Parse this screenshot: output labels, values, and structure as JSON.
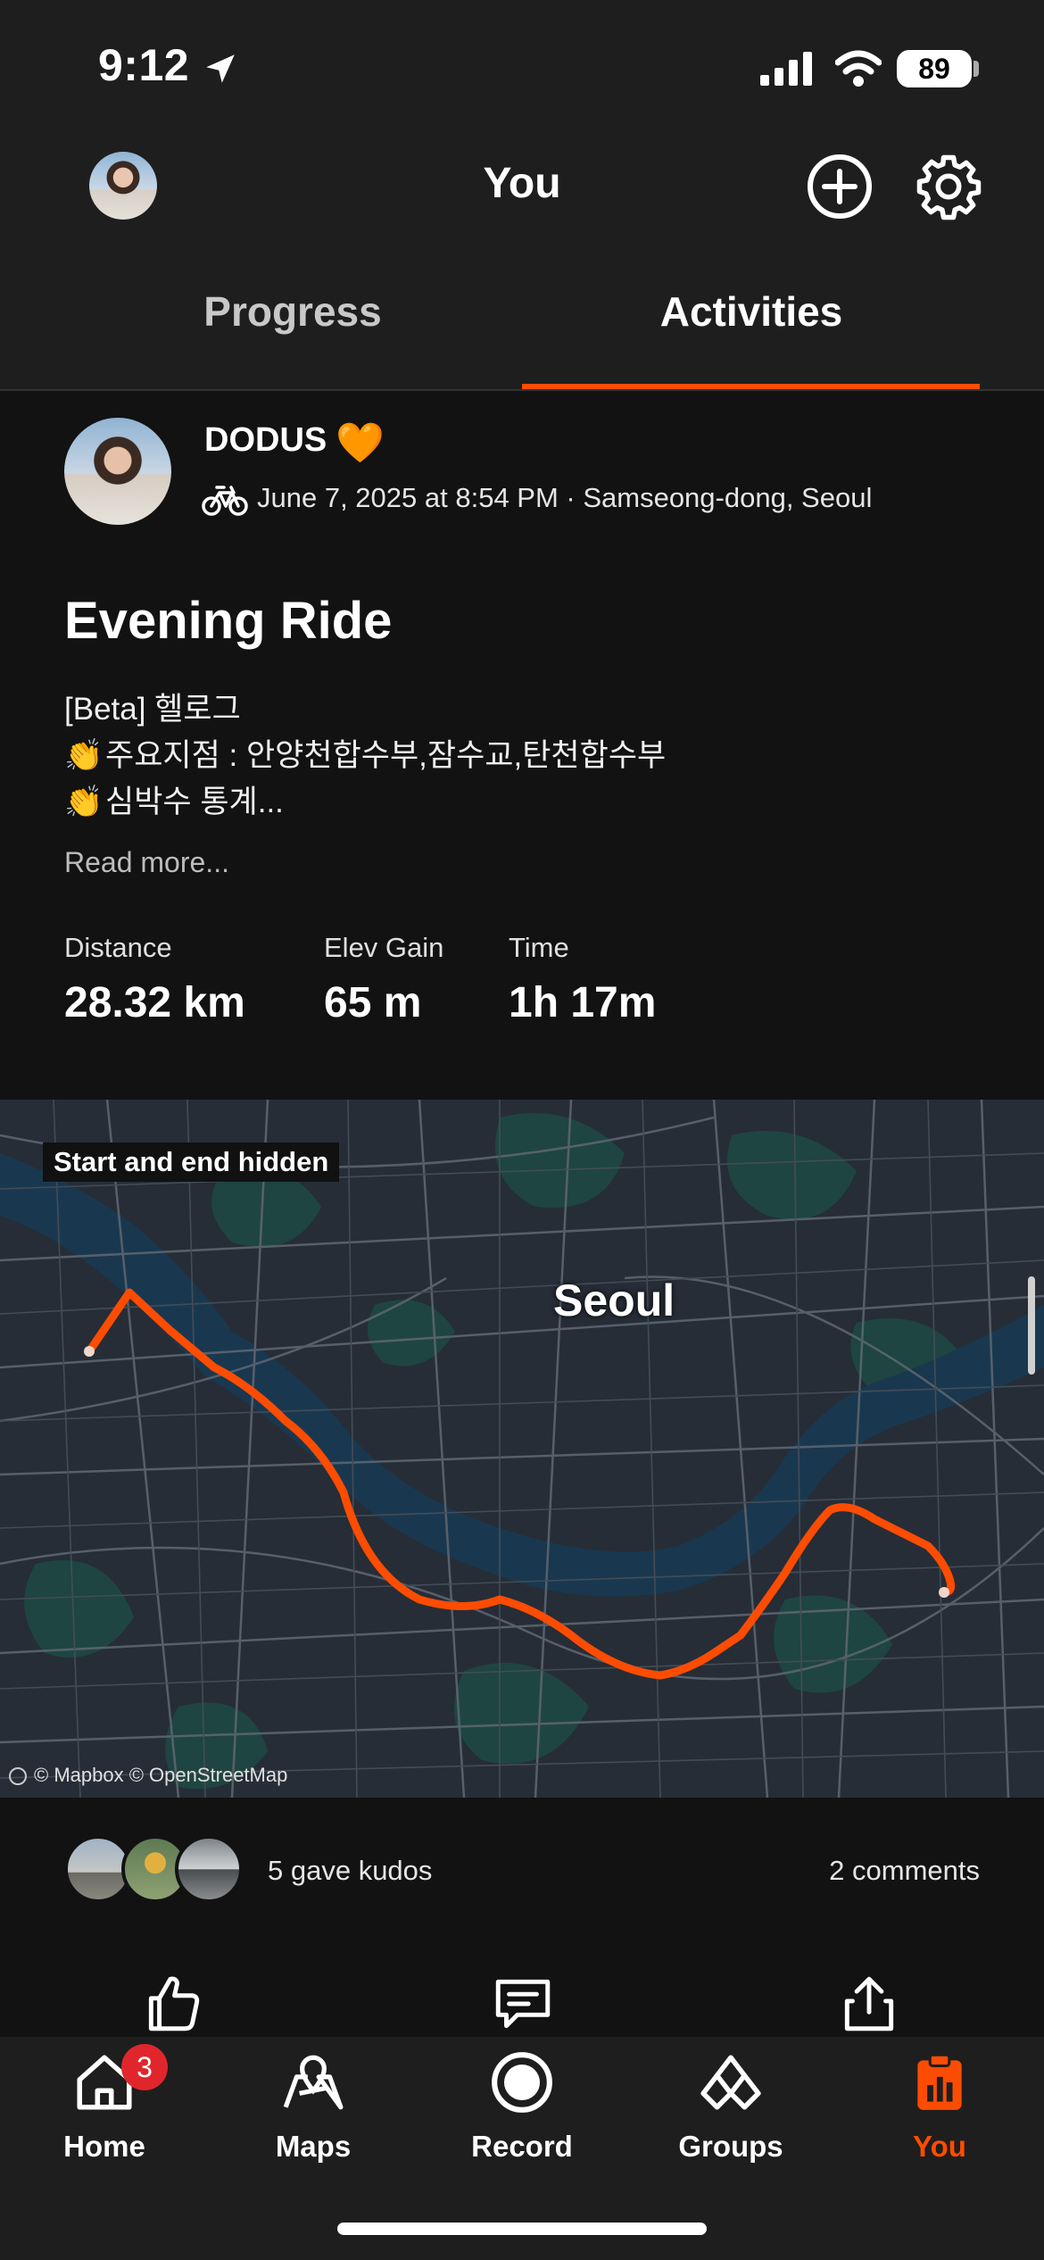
{
  "status_bar": {
    "time": "9:12",
    "battery": "89"
  },
  "header": {
    "title": "You"
  },
  "tabs": [
    {
      "label": "Progress",
      "active": false
    },
    {
      "label": "Activities",
      "active": true
    }
  ],
  "activity": {
    "athlete": "DODUS",
    "meta": "June 7, 2025 at 8:54 PM · Samseong-dong, Seoul",
    "title": "Evening Ride",
    "description": [
      "[Beta] 헬로그",
      "주요지점 : 안양천합수부,잠수교,탄천합수부",
      "심박수 통계..."
    ],
    "read_more": "Read more...",
    "stats": [
      {
        "label": "Distance",
        "value": "28.32 km"
      },
      {
        "label": "Elev Gain",
        "value": "65 m"
      },
      {
        "label": "Time",
        "value": "1h 17m"
      }
    ]
  },
  "map": {
    "badge": "Start and end hidden",
    "city_label": "Seoul",
    "attribution": "© Mapbox © OpenStreetMap",
    "route_color": "#fc4c02"
  },
  "social": {
    "kudos": "5 gave kudos",
    "comments": "2 comments"
  },
  "bottom_nav": [
    {
      "label": "Home",
      "icon": "home-icon",
      "badge": "3",
      "active": false
    },
    {
      "label": "Maps",
      "icon": "maps-icon",
      "active": false
    },
    {
      "label": "Record",
      "icon": "record-icon",
      "active": false
    },
    {
      "label": "Groups",
      "icon": "groups-icon",
      "active": false
    },
    {
      "label": "You",
      "icon": "you-icon",
      "active": true
    }
  ],
  "colors": {
    "accent": "#fc4c02",
    "background": "#121212",
    "bar": "#1e1e1e",
    "badge": "#e0262c"
  }
}
